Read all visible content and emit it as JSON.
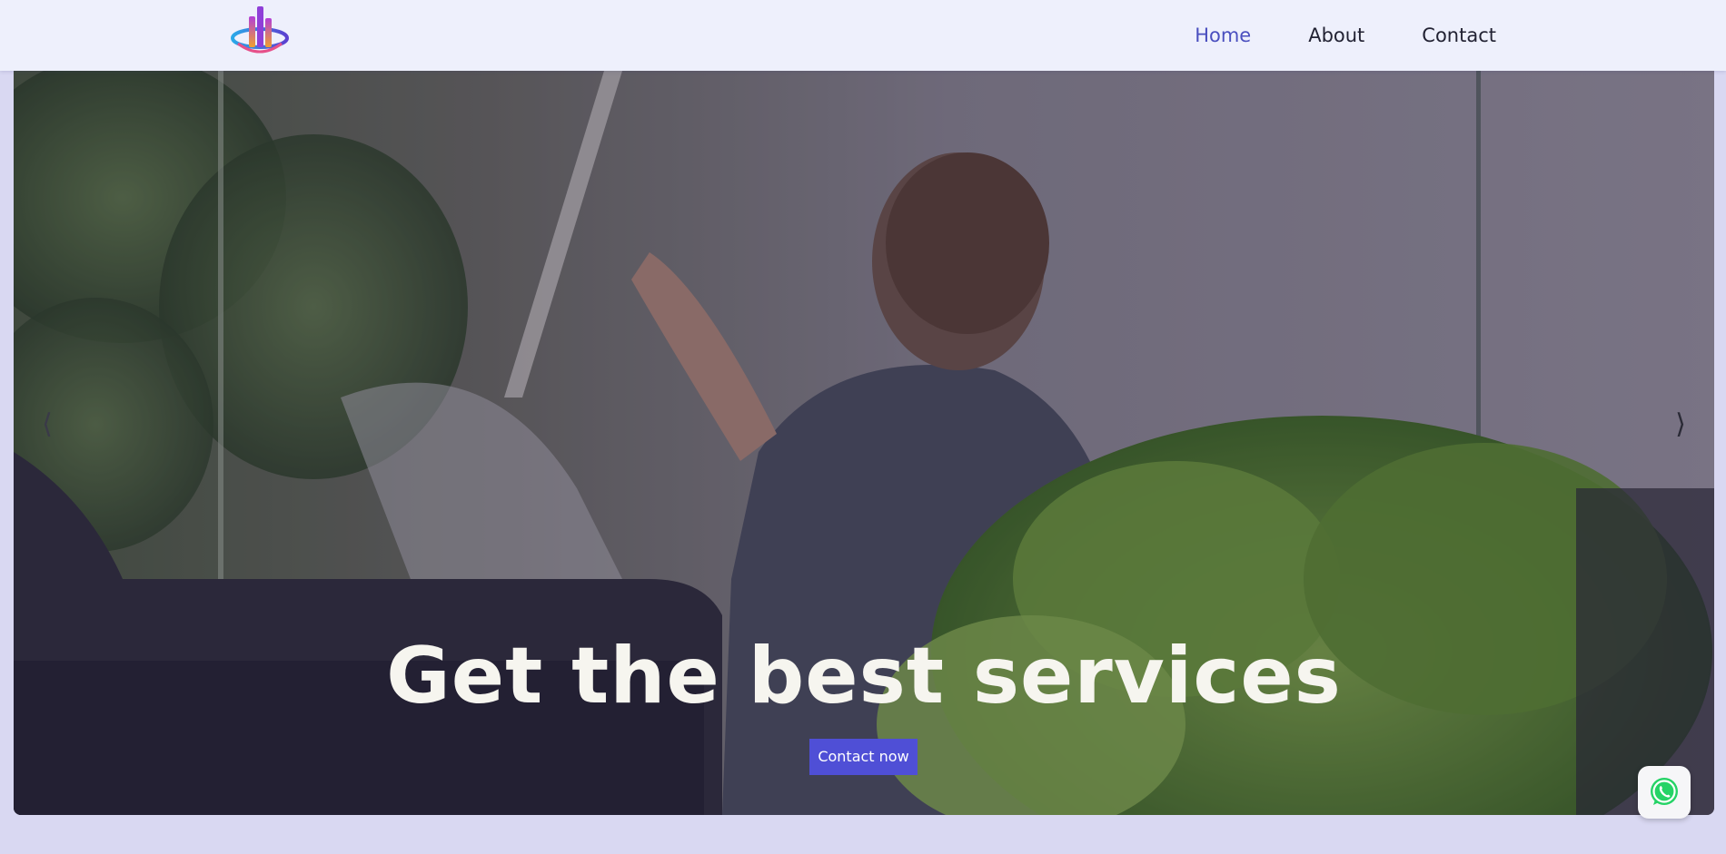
{
  "nav": {
    "logo": "logo-icon",
    "links": [
      {
        "label": "Home",
        "active": true
      },
      {
        "label": "About",
        "active": false
      },
      {
        "label": "Contact",
        "active": false
      }
    ]
  },
  "hero": {
    "title": "Get the best services",
    "cta_label": "Contact now",
    "prev_arrow": "⟨",
    "next_arrow": "⟩"
  },
  "floating": {
    "icon": "whatsapp-icon"
  },
  "colors": {
    "accent": "#4f4fd6",
    "active_nav": "#4a4fbf",
    "navbar_bg": "#eef0fc",
    "page_bg": "#d9d8f2",
    "whatsapp": "#25d366"
  }
}
